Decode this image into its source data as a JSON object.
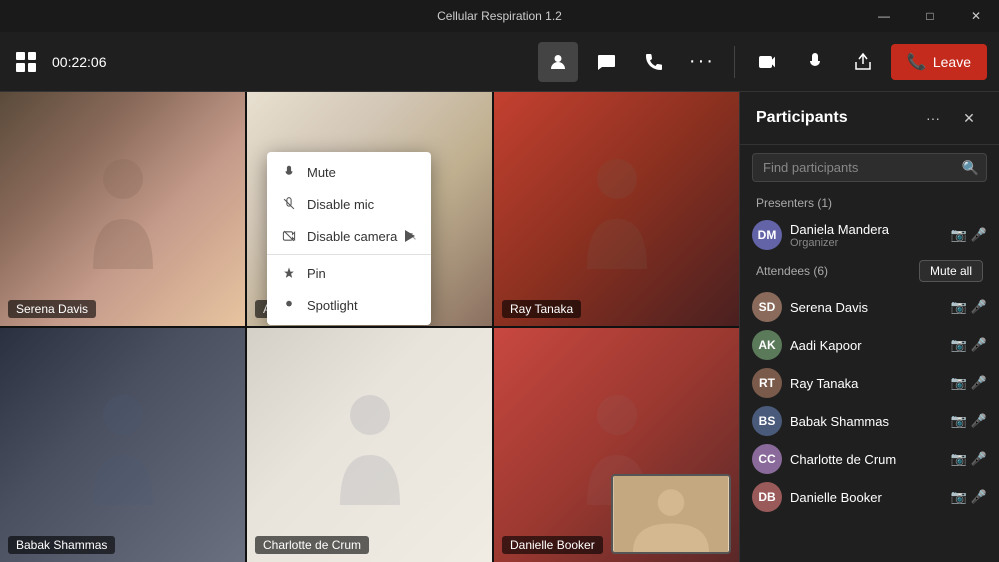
{
  "window": {
    "title": "Cellular Respiration 1.2",
    "controls": {
      "minimize": "—",
      "maximize": "□",
      "close": "✕"
    }
  },
  "toolbar": {
    "timer": "00:22:06",
    "leave_label": "Leave",
    "buttons": {
      "people_label": "People",
      "chat_label": "Chat",
      "call_label": "Call",
      "more_label": "More",
      "camera_label": "Camera",
      "mic_label": "Mic",
      "share_label": "Share"
    }
  },
  "video_grid": {
    "cells": [
      {
        "id": "serena",
        "name": "Serena Davis",
        "has_more": false
      },
      {
        "id": "aadi",
        "name": "Aadi Kapoor",
        "has_more": true
      },
      {
        "id": "ray",
        "name": "Ray Tanaka",
        "has_more": false
      },
      {
        "id": "babak",
        "name": "Babak Shammas",
        "has_more": false
      },
      {
        "id": "charlotte",
        "name": "Charlotte de Crum",
        "has_more": false
      },
      {
        "id": "danielle",
        "name": "Danielle Booker",
        "has_more": false
      }
    ]
  },
  "context_menu": {
    "items": [
      {
        "id": "mute",
        "label": "Mute",
        "icon": "🔇"
      },
      {
        "id": "disable_mic",
        "label": "Disable mic",
        "icon": "🎤"
      },
      {
        "id": "disable_camera",
        "label": "Disable camera",
        "icon": "📷"
      },
      {
        "id": "pin",
        "label": "Pin",
        "icon": "📌"
      },
      {
        "id": "spotlight",
        "label": "Spotlight",
        "icon": "⭐"
      }
    ]
  },
  "participants": {
    "panel_title": "Participants",
    "search_placeholder": "Find participants",
    "presenters_section": "Presenters (1)",
    "attendees_section": "Attendees (6)",
    "mute_all_label": "Mute all",
    "presenters": [
      {
        "id": "daniela",
        "name": "Daniela Mandera",
        "role": "Organizer",
        "avatar_color": "#6264a7",
        "initials": "DM"
      }
    ],
    "attendees": [
      {
        "id": "serena",
        "name": "Serena Davis",
        "avatar_color": "#8a6a5a",
        "initials": "SD"
      },
      {
        "id": "aadi",
        "name": "Aadi Kapoor",
        "avatar_color": "#5a7a5a",
        "initials": "AK"
      },
      {
        "id": "ray",
        "name": "Ray Tanaka",
        "avatar_color": "#7a5a4a",
        "initials": "RT"
      },
      {
        "id": "babak",
        "name": "Babak Shammas",
        "avatar_color": "#4a5a7a",
        "initials": "BS"
      },
      {
        "id": "charlotte",
        "name": "Charlotte de Crum",
        "avatar_color": "#8a6a9a",
        "initials": "CC"
      },
      {
        "id": "danielle",
        "name": "Danielle Booker",
        "avatar_color": "#9a5a5a",
        "initials": "DB"
      }
    ]
  }
}
